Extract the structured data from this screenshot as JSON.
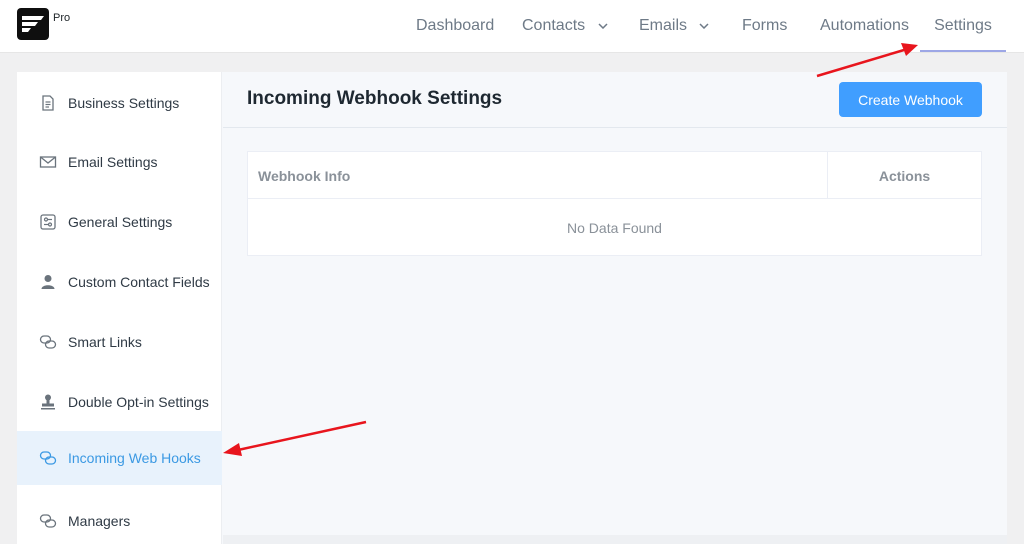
{
  "app": {
    "badge": "Pro",
    "colors": {
      "accent": "#409eff",
      "active_text": "#3b99e3",
      "annotation": "#e8151d"
    }
  },
  "nav": {
    "items": [
      {
        "label": "Dashboard"
      },
      {
        "label": "Contacts"
      },
      {
        "label": "Emails"
      },
      {
        "label": "Forms"
      },
      {
        "label": "Automations"
      },
      {
        "label": "Settings",
        "active": true
      }
    ]
  },
  "sidebar": {
    "items": [
      {
        "label": "Business Settings",
        "icon": "document-icon"
      },
      {
        "label": "Email Settings",
        "icon": "envelope-icon"
      },
      {
        "label": "General Settings",
        "icon": "sliders-icon"
      },
      {
        "label": "Custom Contact Fields",
        "icon": "user-icon"
      },
      {
        "label": "Smart Links",
        "icon": "link-icon"
      },
      {
        "label": "Double Opt-in Settings",
        "icon": "stamp-icon"
      },
      {
        "label": "Incoming Web Hooks",
        "icon": "link-icon",
        "active": true
      },
      {
        "label": "Managers",
        "icon": "link-icon"
      }
    ]
  },
  "main": {
    "title": "Incoming Webhook Settings",
    "create_button": "Create Webhook",
    "table": {
      "columns": [
        "Webhook Info",
        "Actions"
      ],
      "empty_text": "No Data Found"
    }
  }
}
